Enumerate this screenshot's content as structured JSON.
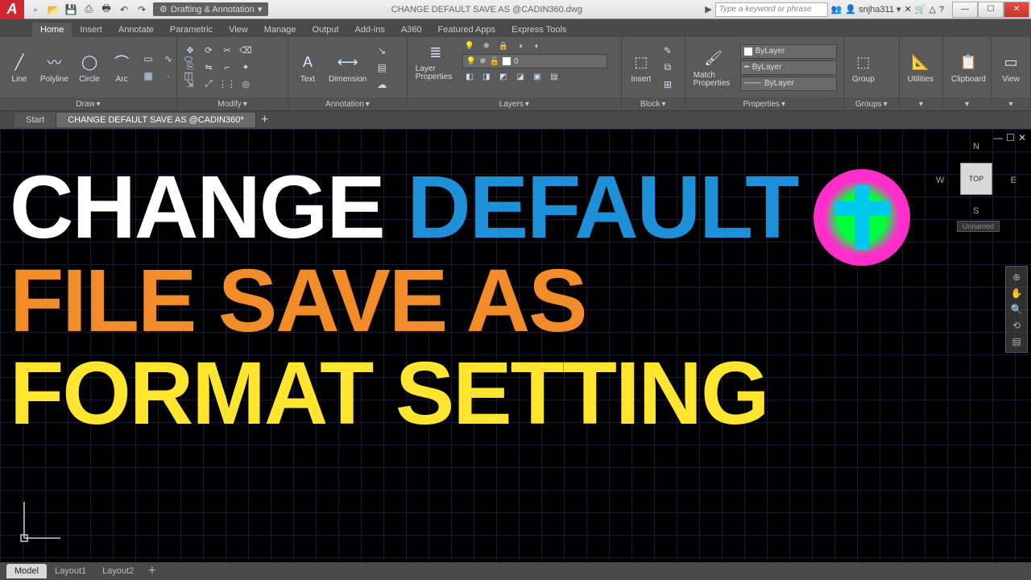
{
  "titlebar": {
    "app_letter": "A",
    "workspace": "Drafting & Annotation",
    "filename": "CHANGE DEFAULT SAVE AS @CADIN360.dwg",
    "search_placeholder": "Type a keyword or phrase",
    "username": "snjha311"
  },
  "ribbon": {
    "tabs": [
      "Home",
      "Insert",
      "Annotate",
      "Parametric",
      "View",
      "Manage",
      "Output",
      "Add-ins",
      "A360",
      "Featured Apps",
      "Express Tools"
    ],
    "active_tab": "Home",
    "panels": {
      "draw": {
        "title": "Draw",
        "items": [
          "Line",
          "Polyline",
          "Circle",
          "Arc"
        ]
      },
      "modify": {
        "title": "Modify"
      },
      "annotation": {
        "title": "Annotation",
        "items": [
          "Text",
          "Dimension"
        ]
      },
      "layers": {
        "title": "Layers",
        "layer_prop": "Layer Properties",
        "current_layer": "0"
      },
      "block": {
        "title": "Block",
        "insert": "Insert"
      },
      "properties": {
        "title": "Properties",
        "match": "Match Properties",
        "bylayer": "ByLayer"
      },
      "groups": {
        "title": "Groups",
        "group": "Group"
      },
      "utilities": {
        "title": "Utilities"
      },
      "clipboard": {
        "title": "Clipboard"
      },
      "view": {
        "title": "View"
      }
    }
  },
  "file_tabs": {
    "items": [
      "Start",
      "CHANGE DEFAULT SAVE AS @CADIN360*"
    ],
    "active": 1
  },
  "viewcube": {
    "face": "TOP",
    "wcs": "Unnamed",
    "n": "N",
    "s": "S",
    "e": "E",
    "w": "W"
  },
  "overlay": {
    "l1a": "CHANGE",
    "l1b": "DEFAULT",
    "l2": "FILE SAVE AS",
    "l3": "FORMAT SETTING"
  },
  "bottom_tabs": {
    "items": [
      "Model",
      "Layout1",
      "Layout2"
    ],
    "active": 0
  }
}
